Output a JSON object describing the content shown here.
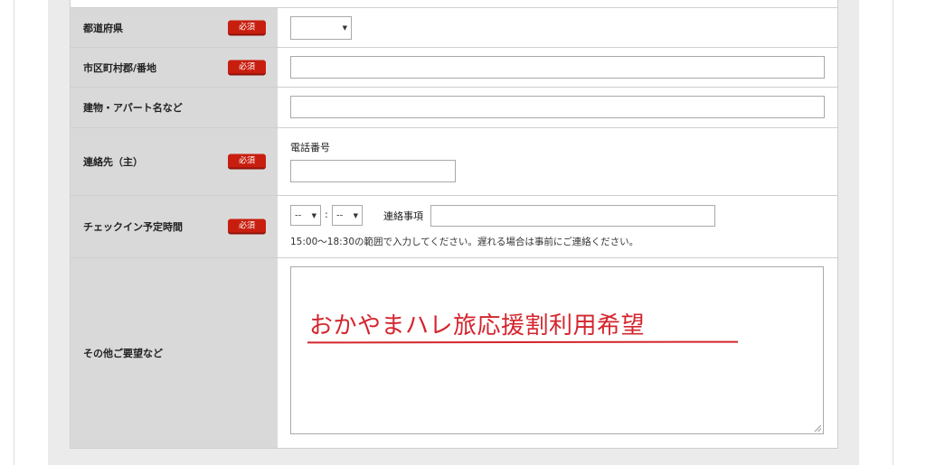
{
  "required_label": "必須",
  "form": {
    "prefecture": {
      "label": "都道府県",
      "selected": ""
    },
    "city_address": {
      "label": "市区町村郡/番地",
      "value": ""
    },
    "building": {
      "label": "建物・アパート名など",
      "value": ""
    },
    "contact": {
      "label": "連絡先（主）",
      "sub_label": "電話番号",
      "value": ""
    },
    "checkin": {
      "label": "チェックイン予定時間",
      "hour": "--",
      "separator": ":",
      "minute": "--",
      "notes_label": "連絡事項",
      "notes_value": "",
      "hint": "15:00～18:30の範囲で入力してください。遅れる場合は事前にご連絡ください。"
    },
    "other": {
      "label": "その他ご要望など",
      "value": "おかやまハレ旅応援割利用希望"
    }
  },
  "colors": {
    "required_badge": "#c81e0f",
    "handwriting": "#d4252d",
    "label_bg": "#d9d9d9"
  }
}
